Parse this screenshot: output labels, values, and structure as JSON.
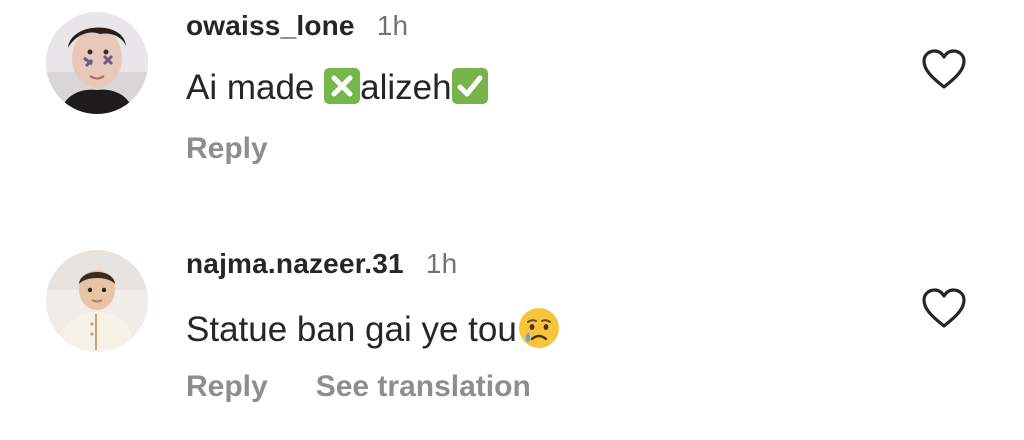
{
  "comments": [
    {
      "username": "owaiss_lone",
      "time": "1h",
      "text_parts": [
        "Ai made ",
        "alizeh"
      ],
      "emojis": [
        "cross-mark-button-emoji",
        "check-mark-button-emoji"
      ],
      "reply_label": "Reply",
      "avatar": "avatar-boy-face-paint"
    },
    {
      "username": "najma.nazeer.31",
      "time": "1h",
      "text": "Statue ban gai ye tou",
      "emojis": [
        "crying-face-emoji"
      ],
      "reply_label": "Reply",
      "see_translation_label": "See translation",
      "avatar": "avatar-baby"
    }
  ],
  "icons": {
    "like": "heart-outline-icon"
  },
  "colors": {
    "username": "#262626",
    "meta": "#737373",
    "action": "#8e8e8e",
    "emoji_green": "#75b84a",
    "emoji_face": "#f7c53c",
    "tear": "#5ca6e0"
  }
}
